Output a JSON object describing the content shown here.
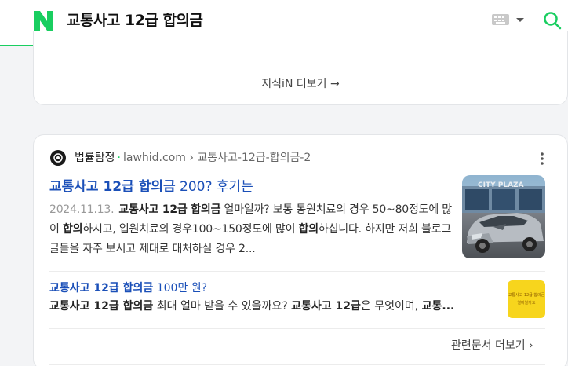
{
  "header": {
    "query": "교통사고 12급 합의금",
    "logo_letter": "N",
    "brand_color": "#19ce60"
  },
  "kin_more": {
    "label": "지식iN 더보기 →"
  },
  "result": {
    "source_name": "법률탐정",
    "source_domain": "lawhid.com",
    "source_path": "› 교통사고-12급-합의금-2",
    "title_bold": "교통사고 12급 합의금",
    "title_rest": " 200? 후기는",
    "date": "2024.11.13.",
    "desc_parts": [
      {
        "t": "교통사고 12급 합의금",
        "b": true
      },
      {
        "t": " 얼마일까? 보통 통원치료의 경우 50~80정도에 많이 ",
        "b": false
      },
      {
        "t": "합의",
        "b": true
      },
      {
        "t": "하시고, 입원치료의 경우100~150정도에 많이 ",
        "b": false
      },
      {
        "t": "합의",
        "b": true
      },
      {
        "t": "하십니다. 하지만 저희 블로그글들을 자주 보시고 제대로 대처하실 경우 2...",
        "b": false
      }
    ],
    "thumb_text": "CITY PLAZA"
  },
  "sub": {
    "title_bold": "교통사고 12급 합의금",
    "title_rest": " 100만 원?",
    "desc_parts": [
      {
        "t": "교통사고 12급 합의금",
        "b": true
      },
      {
        "t": " 최대 얼마 받을 수 있을까요? ",
        "b": false
      },
      {
        "t": "교통사고 12급",
        "b": true
      },
      {
        "t": "은 무엇이며, ",
        "b": false
      },
      {
        "t": "교통...",
        "b": true
      }
    ],
    "thumb_lines": [
      "교통사고 12급 합의금",
      "얼마일까요"
    ]
  },
  "related_more": {
    "label": "관련문서 더보기 ›"
  }
}
